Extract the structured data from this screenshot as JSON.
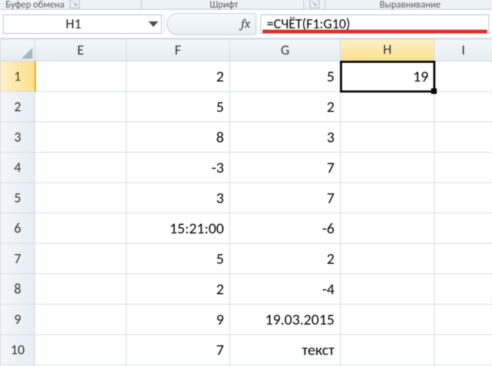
{
  "ribbon": {
    "group1": "Буфер обмена",
    "group2": "Шрифт",
    "group3": "Выравнивание"
  },
  "name_box": {
    "value": "H1"
  },
  "fx_label": "fx",
  "formula": "=СЧЁТ(F1:G10)",
  "columns": [
    "E",
    "F",
    "G",
    "H",
    "I"
  ],
  "active_col": "H",
  "active_row": "1",
  "rows": [
    {
      "n": "1",
      "E": "",
      "F": "2",
      "G": "5",
      "H": "19",
      "I": ""
    },
    {
      "n": "2",
      "E": "",
      "F": "5",
      "G": "2",
      "H": "",
      "I": ""
    },
    {
      "n": "3",
      "E": "",
      "F": "8",
      "G": "3",
      "H": "",
      "I": ""
    },
    {
      "n": "4",
      "E": "",
      "F": "-3",
      "G": "7",
      "H": "",
      "I": ""
    },
    {
      "n": "5",
      "E": "",
      "F": "3",
      "G": "7",
      "H": "",
      "I": ""
    },
    {
      "n": "6",
      "E": "",
      "F": "15:21:00",
      "G": "-6",
      "H": "",
      "I": ""
    },
    {
      "n": "7",
      "E": "",
      "F": "5",
      "G": "2",
      "H": "",
      "I": ""
    },
    {
      "n": "8",
      "E": "",
      "F": "2",
      "G": "-4",
      "H": "",
      "I": ""
    },
    {
      "n": "9",
      "E": "",
      "F": "9",
      "G": "19.03.2015",
      "H": "",
      "I": ""
    },
    {
      "n": "10",
      "E": "",
      "F": "7",
      "G": "текст",
      "H": "",
      "I": ""
    }
  ]
}
